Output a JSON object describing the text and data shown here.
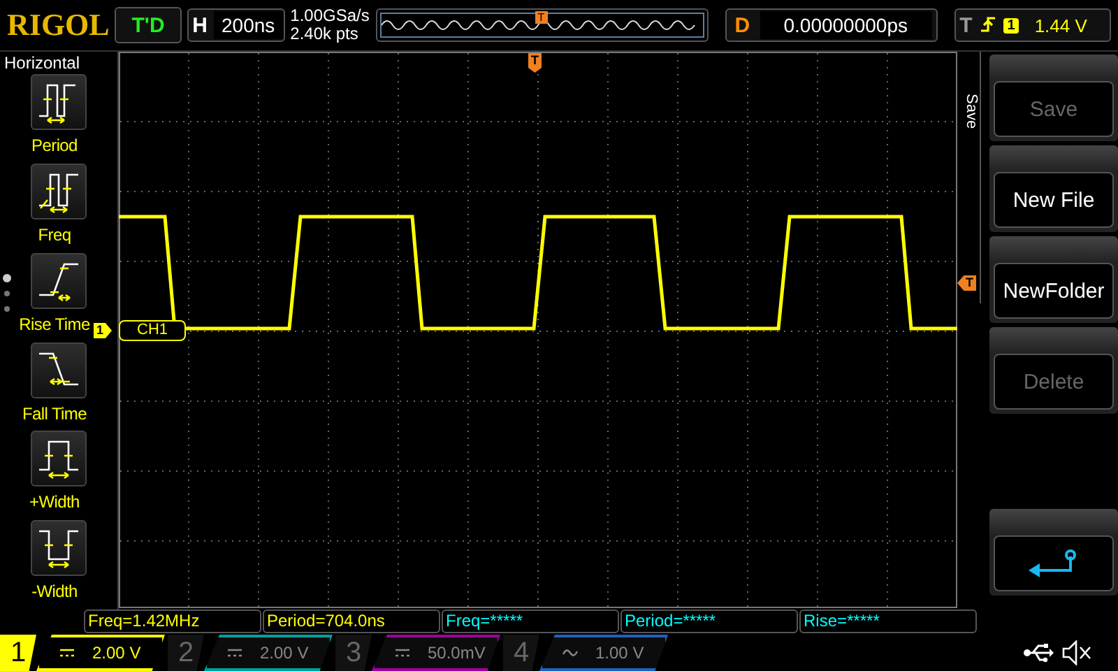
{
  "header": {
    "logo": "RIGOL",
    "run_status": "T'D",
    "timebase": {
      "label": "H",
      "value": "200ns"
    },
    "sample_rate": "1.00GSa/s",
    "memory_depth": "2.40k pts",
    "trigger_position_marker": "T",
    "delay": {
      "label": "D",
      "value": "0.00000000ps"
    },
    "trigger": {
      "label": "T",
      "channel": "1",
      "level": "1.44 V"
    }
  },
  "sidebar": {
    "title": "Horizontal",
    "items": [
      {
        "label": "Period",
        "kind": "period"
      },
      {
        "label": "Freq",
        "kind": "freq"
      },
      {
        "label": "Rise Time",
        "kind": "rise"
      },
      {
        "label": "Fall Time",
        "kind": "fall"
      },
      {
        "label": "+Width",
        "kind": "pwidth"
      },
      {
        "label": "-Width",
        "kind": "nwidth"
      }
    ]
  },
  "screen": {
    "trigger_marker": "T",
    "trigger_level_marker": "T",
    "channel_marker": "1",
    "channel_label": "CH1"
  },
  "menu": {
    "title": "Save",
    "buttons": [
      {
        "kind": "text",
        "label": "Save",
        "disabled": true
      },
      {
        "kind": "text",
        "label": "New File",
        "disabled": false
      },
      {
        "kind": "text",
        "label": "NewFolder",
        "disabled": false
      },
      {
        "kind": "text",
        "label": "Delete",
        "disabled": true
      },
      {
        "kind": "blank"
      },
      {
        "kind": "back"
      }
    ]
  },
  "measurements": [
    {
      "text": "Freq=1.42MHz",
      "color": "#ffff00"
    },
    {
      "text": "Period=704.0ns",
      "color": "#ffff00"
    },
    {
      "text": "Freq=*****",
      "color": "#00ffff"
    },
    {
      "text": "Period=*****",
      "color": "#00ffff"
    },
    {
      "text": "Rise=*****",
      "color": "#00ffff"
    }
  ],
  "channels": [
    {
      "number": "1",
      "kind": "dc",
      "scale": "2.00 V",
      "active": true,
      "color": "#ffff00"
    },
    {
      "number": "2",
      "kind": "dc",
      "scale": "2.00 V",
      "active": false,
      "color": "#00a0a0"
    },
    {
      "number": "3",
      "kind": "dc",
      "scale": "50.0mV",
      "active": false,
      "color": "#a000a0"
    },
    {
      "number": "4",
      "kind": "ac",
      "scale": "1.00 V",
      "active": false,
      "color": "#2060c0"
    }
  ]
}
